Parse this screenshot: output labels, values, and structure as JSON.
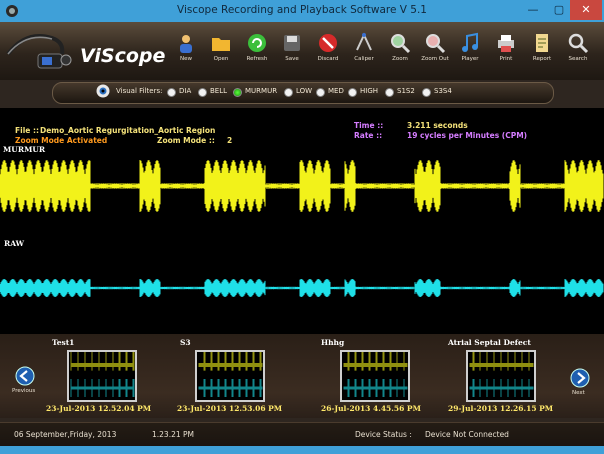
{
  "window": {
    "title": "Viscope Recording and Playback Software V 5.1",
    "min_label": "—",
    "max_label": "▢",
    "close_label": "✕"
  },
  "logo": {
    "text": "ViScope"
  },
  "toolbar": {
    "items": [
      {
        "label": "New",
        "icon": "person-icon"
      },
      {
        "label": "Open",
        "icon": "folder-icon"
      },
      {
        "label": "Refresh",
        "icon": "refresh-icon"
      },
      {
        "label": "Save",
        "icon": "save-icon"
      },
      {
        "label": "Discard",
        "icon": "discard-icon"
      },
      {
        "label": "Caliper",
        "icon": "caliper-icon"
      },
      {
        "label": "Zoom",
        "icon": "zoom-in-icon"
      },
      {
        "label": "Zoom Out",
        "icon": "zoom-out-icon"
      },
      {
        "label": "Player",
        "icon": "music-note-icon"
      },
      {
        "label": "Print",
        "icon": "printer-icon"
      },
      {
        "label": "Report",
        "icon": "report-icon"
      },
      {
        "label": "Search",
        "icon": "search-icon"
      }
    ]
  },
  "filters": {
    "label": "Visual Filters:",
    "options": [
      {
        "label": "DIA",
        "selected": false
      },
      {
        "label": "BELL",
        "selected": false
      },
      {
        "label": "MURMUR",
        "selected": true
      },
      {
        "label": "LOW",
        "selected": false
      },
      {
        "label": "MED",
        "selected": false
      },
      {
        "label": "HIGH",
        "selected": false
      },
      {
        "label": "S1S2",
        "selected": false
      },
      {
        "label": "S3S4",
        "selected": false
      }
    ]
  },
  "info": {
    "file_label": "File ::",
    "file_name": "Demo_Aortic Regurgitation_Aortic Region",
    "zoom_status": "Zoom Mode Activated",
    "zoom_mode_label": "Zoom Mode ::",
    "zoom_mode_value": "2",
    "time_label": "Time ::",
    "time_value": "3.211 seconds",
    "rate_label": "Rate ::",
    "rate_value": "19 cycles per Minutes (CPM)"
  },
  "channels": {
    "top": "MURMUR",
    "bottom": "RAW"
  },
  "colors": {
    "murmur": "#f2f21a",
    "raw": "#1fe0e8",
    "accent": "#3fa0d8"
  },
  "recordings": [
    {
      "name": "Test1",
      "date": "23-Jul-2013 12.52.04 PM"
    },
    {
      "name": "S3",
      "date": "23-Jul-2013 12.53.06 PM"
    },
    {
      "name": "Hhhg",
      "date": "26-Jul-2013 4.45.56 PM"
    },
    {
      "name": "Atrial Septal Defect",
      "date": "29-Jul-2013 12.26.15 PM"
    }
  ],
  "nav": {
    "previous": "Previous",
    "next": "Next"
  },
  "status": {
    "date": "06 September,Friday, 2013",
    "time": "1.23.21 PM",
    "device_label": "Device Status :",
    "device_value": "Device Not Connected"
  }
}
